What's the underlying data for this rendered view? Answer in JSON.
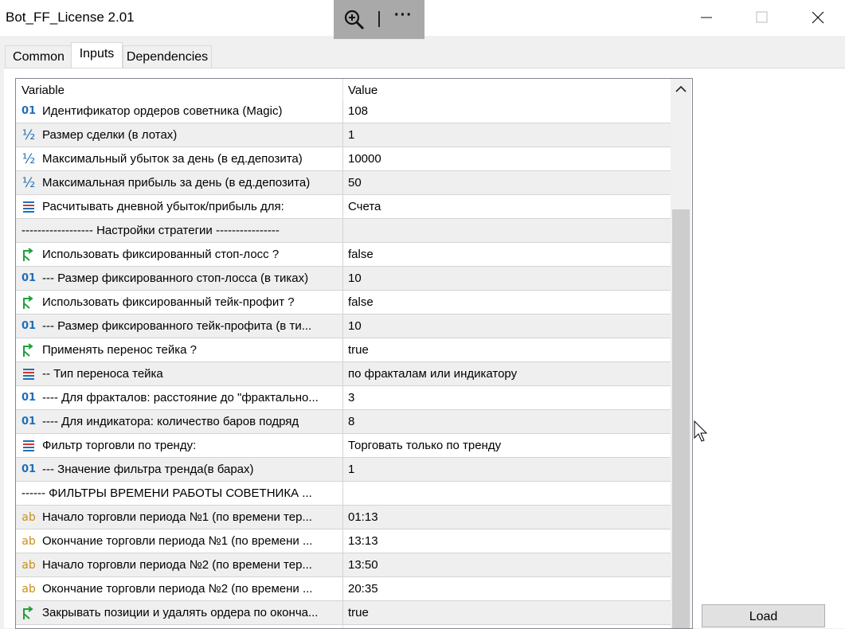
{
  "window": {
    "title": "Bot_FF_License 2.01"
  },
  "tabs": [
    {
      "label": "Common"
    },
    {
      "label": "Inputs"
    },
    {
      "label": "Dependencies"
    }
  ],
  "grid": {
    "headers": {
      "variable": "Variable",
      "value": "Value"
    },
    "rows": [
      {
        "icon": "int-icon",
        "name": "Идентификатор ордеров советника (Magic)",
        "value": "108"
      },
      {
        "icon": "double-icon",
        "name": "Размер сделки (в лотах)",
        "value": "1"
      },
      {
        "icon": "double-icon",
        "name": "Максимальный убыток за день (в ед.депозита)",
        "value": "10000"
      },
      {
        "icon": "double-icon",
        "name": "Максимальная прибыль за день (в ед.депозита)",
        "value": "50"
      },
      {
        "icon": "enum-icon",
        "name": "Расчитывать дневной убыток/прибыль для:",
        "value": "Счета"
      },
      {
        "icon": "none",
        "name": "------------------    Настройки стратегии    ----------------",
        "value": ""
      },
      {
        "icon": "bool-icon",
        "name": "Использовать фиксированный стоп-лосс ?",
        "value": "false"
      },
      {
        "icon": "int-icon",
        "name": "--- Размер фиксированного стоп-лосса (в тиках)",
        "value": "10"
      },
      {
        "icon": "bool-icon",
        "name": "Использовать фиксированный тейк-профит ?",
        "value": "false"
      },
      {
        "icon": "int-icon",
        "name": "--- Размер фиксированного тейк-профита (в ти...",
        "value": "10"
      },
      {
        "icon": "bool-icon",
        "name": "Применять перенос тейка ?",
        "value": "true"
      },
      {
        "icon": "enum-icon",
        "name": "-- Тип переноса тейка",
        "value": "по фракталам или индикатору"
      },
      {
        "icon": "int-icon",
        "name": "---- Для фракталов: расстояние до \"фрактально...",
        "value": "3"
      },
      {
        "icon": "int-icon",
        "name": "---- Для индикатора: количество баров подряд",
        "value": "8"
      },
      {
        "icon": "enum-icon",
        "name": "Фильтр торговли по тренду:",
        "value": "Торговать только по тренду"
      },
      {
        "icon": "int-icon",
        "name": "--- Значение фильтра тренда(в барах)",
        "value": "1"
      },
      {
        "icon": "none",
        "name": "------    ФИЛЬТРЫ ВРЕМЕНИ РАБОТЫ СОВЕТНИКА    ...",
        "value": ""
      },
      {
        "icon": "string-icon",
        "name": "Начало торговли периода №1 (по времени тер...",
        "value": "01:13"
      },
      {
        "icon": "string-icon",
        "name": "Окончание торговли периода №1 (по времени ...",
        "value": "13:13"
      },
      {
        "icon": "string-icon",
        "name": "Начало торговли периода №2 (по времени тер...",
        "value": "13:50"
      },
      {
        "icon": "string-icon",
        "name": "Окончание торговли периода №2 (по времени ...",
        "value": "20:35"
      },
      {
        "icon": "bool-icon",
        "name": "Закрывать позиции и удалять ордера по оконча...",
        "value": "true"
      }
    ]
  },
  "buttons": {
    "load": "Load"
  }
}
